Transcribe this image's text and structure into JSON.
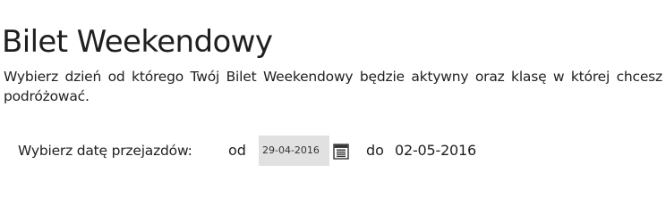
{
  "title": "Bilet Weekendowy",
  "description": "Wybierz dzień od którego Twój Bilet Weekendowy będzie aktywny oraz klasę w której chcesz podróżować.",
  "date_selection": {
    "label": "Wybierz datę przejazdów:",
    "from_label": "od",
    "from_value": "29-04-2016",
    "to_label": "do",
    "to_value": "02-05-2016",
    "calendar_icon": "calendar-icon"
  },
  "colors": {
    "input_background": "#e1e1e1",
    "text": "#1f1f1f"
  }
}
